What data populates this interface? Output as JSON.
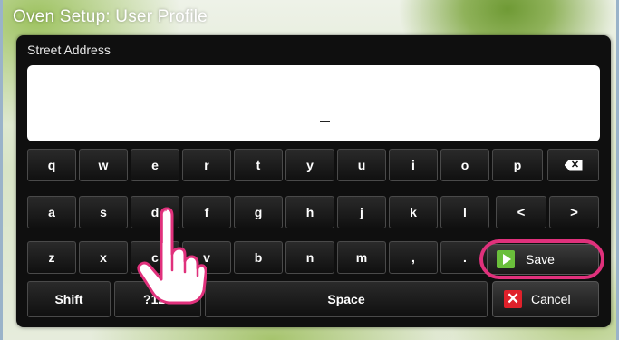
{
  "window": {
    "title": "Oven Setup: User Profile"
  },
  "form": {
    "field_label": "Street Address",
    "field_value": ""
  },
  "keyboard": {
    "row1": [
      "q",
      "w",
      "e",
      "r",
      "t",
      "y",
      "u",
      "i",
      "o",
      "p"
    ],
    "row2": [
      "a",
      "s",
      "d",
      "f",
      "g",
      "h",
      "j",
      "k",
      "l"
    ],
    "row3": [
      "z",
      "x",
      "c",
      "v",
      "b",
      "n",
      "m",
      ",",
      "."
    ],
    "backspace_icon": "backspace-icon",
    "left_arrow": "<",
    "right_arrow": ">",
    "shift_label": "Shift",
    "symbols_label": "?123",
    "space_label": "Space"
  },
  "actions": {
    "save_label": "Save",
    "save_icon": "play-icon",
    "cancel_label": "Cancel",
    "cancel_icon": "close-icon",
    "highlight_color": "#e0317c",
    "save_icon_color": "#6abf3b",
    "cancel_icon_color": "#e0212b"
  },
  "overlay": {
    "pointer_icon": "hand-pointer-icon"
  }
}
